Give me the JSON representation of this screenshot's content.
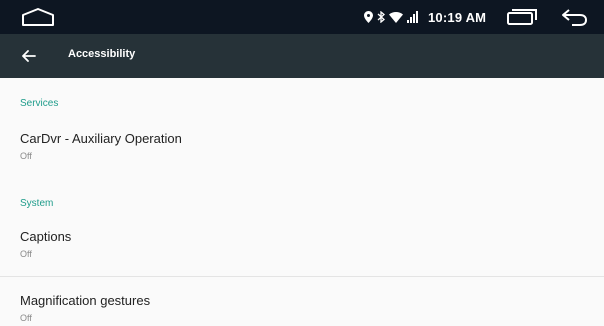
{
  "status_bar": {
    "time": "10:19 AM",
    "icons": [
      "location-icon",
      "bluetooth-icon",
      "wifi-icon",
      "cellular-signal-icon"
    ],
    "nav_buttons": [
      "home-icon",
      "recents-icon",
      "back-arrow-icon"
    ]
  },
  "app_bar": {
    "title": "Accessibility",
    "back_icon": "arrow-left-icon"
  },
  "sections": [
    {
      "header": "Services",
      "items": [
        {
          "title": "CarDvr - Auxiliary Operation",
          "summary": "Off"
        }
      ]
    },
    {
      "header": "System",
      "items": [
        {
          "title": "Captions",
          "summary": "Off"
        },
        {
          "title": "Magnification gestures",
          "summary": "Off"
        }
      ]
    }
  ],
  "colors": {
    "status_bar_bg": "#0d1622",
    "app_bar_bg": "#263238",
    "accent": "#1f9c8b",
    "background": "#fafafa"
  }
}
